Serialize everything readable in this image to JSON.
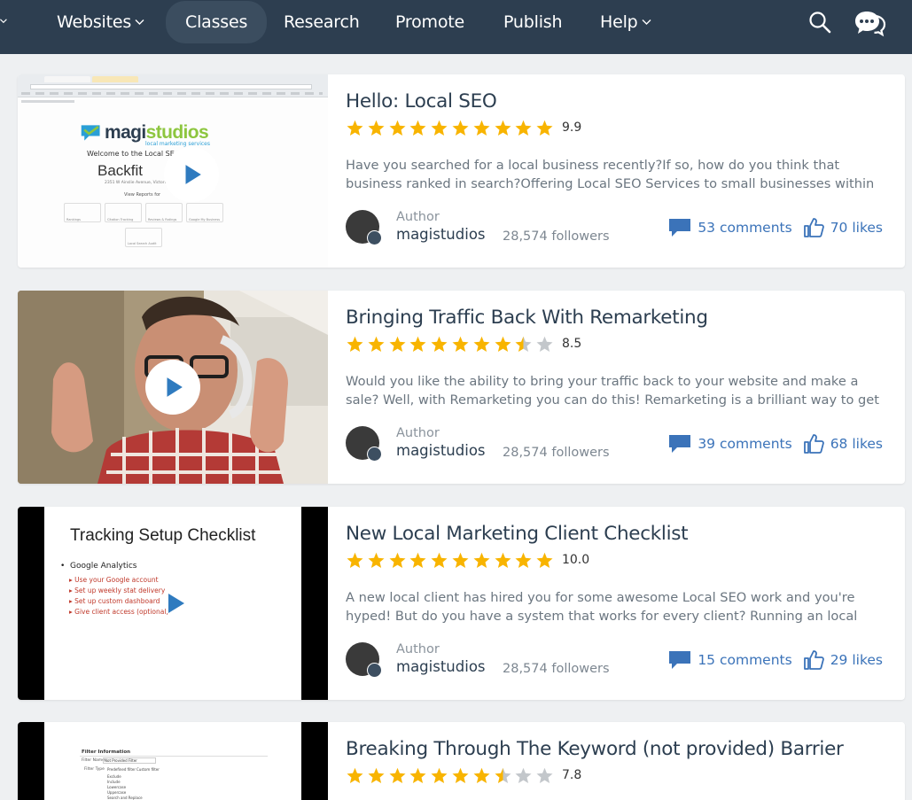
{
  "nav": {
    "items": [
      {
        "label": "Websites",
        "has_chevron": true
      },
      {
        "label": "Classes",
        "active": true
      },
      {
        "label": "Research"
      },
      {
        "label": "Promote"
      },
      {
        "label": "Publish"
      },
      {
        "label": "Help",
        "has_chevron": true
      }
    ],
    "icons": [
      "search-icon",
      "chat-icon"
    ],
    "bg_color": "#2d3e50"
  },
  "posts": [
    {
      "title": "Hello: Local SEO",
      "rating": 9.9,
      "score": "9.9",
      "description": "Have you searched for a local business recently?If so, how do you think that business ranked in search?Offering Local SEO Services to small businesses within your own local",
      "author_label": "Author",
      "author": "magistudios",
      "followers": "28,574 followers",
      "comments": "53 comments",
      "likes": "70 likes",
      "thumb": {
        "logo_text": "magistudios",
        "logo_sub": "local marketing services",
        "welcome": "Welcome to the Local SE",
        "business": "Backfit",
        "address": "2351 W Ainslie Avenue, Victoria, BBP's",
        "reports": "View Reports for",
        "tiles": [
          "Rankings",
          "Citation Tracking",
          "Reviews & Ratings",
          "Google My Business",
          "Local Search Audit"
        ]
      }
    },
    {
      "title": "Bringing Traffic Back With Remarketing",
      "rating": 8.5,
      "score": "8.5",
      "description": "Would you like the ability to bring your traffic back to your website and make a sale? Well, with Remarketing you can do this! Remarketing is a brilliant way to get lost traffic",
      "author_label": "Author",
      "author": "magistudios",
      "followers": "28,574 followers",
      "comments": "39 comments",
      "likes": "68 likes"
    },
    {
      "title": "New Local Marketing Client Checklist",
      "rating": 10.0,
      "score": "10.0",
      "description": "A new local client has hired you for some awesome Local SEO work and you're hyped! But do you have a system that works for every client? Running an local online",
      "author_label": "Author",
      "author": "magistudios",
      "followers": "28,574 followers",
      "comments": "15 comments",
      "likes": "29 likes",
      "thumb": {
        "heading": "Tracking Setup Checklist",
        "bullet": "Google Analytics",
        "subitems": [
          "Use your Google account",
          "Set up weekly stat delivery",
          "Set up custom dashboard",
          "Give client access (optional,"
        ]
      }
    },
    {
      "title": "Breaking Through The Keyword (not provided) Barrier",
      "rating": 7.8,
      "score": "7.8",
      "thumb": {
        "heading": "Filter Information",
        "rows": [
          "Filter Name",
          "Filter Type"
        ],
        "values": [
          "Not Provided Filter",
          "Predefined filter",
          "Custom filter"
        ],
        "options": [
          "Exclude",
          "Include",
          "Lowercase",
          "Uppercase",
          "Search and Replace"
        ]
      }
    }
  ],
  "colors": {
    "star_on": "#f8b400",
    "star_off": "#c3c7cb",
    "link_blue": "#3b73b9",
    "page_bg": "#eef0f2"
  }
}
